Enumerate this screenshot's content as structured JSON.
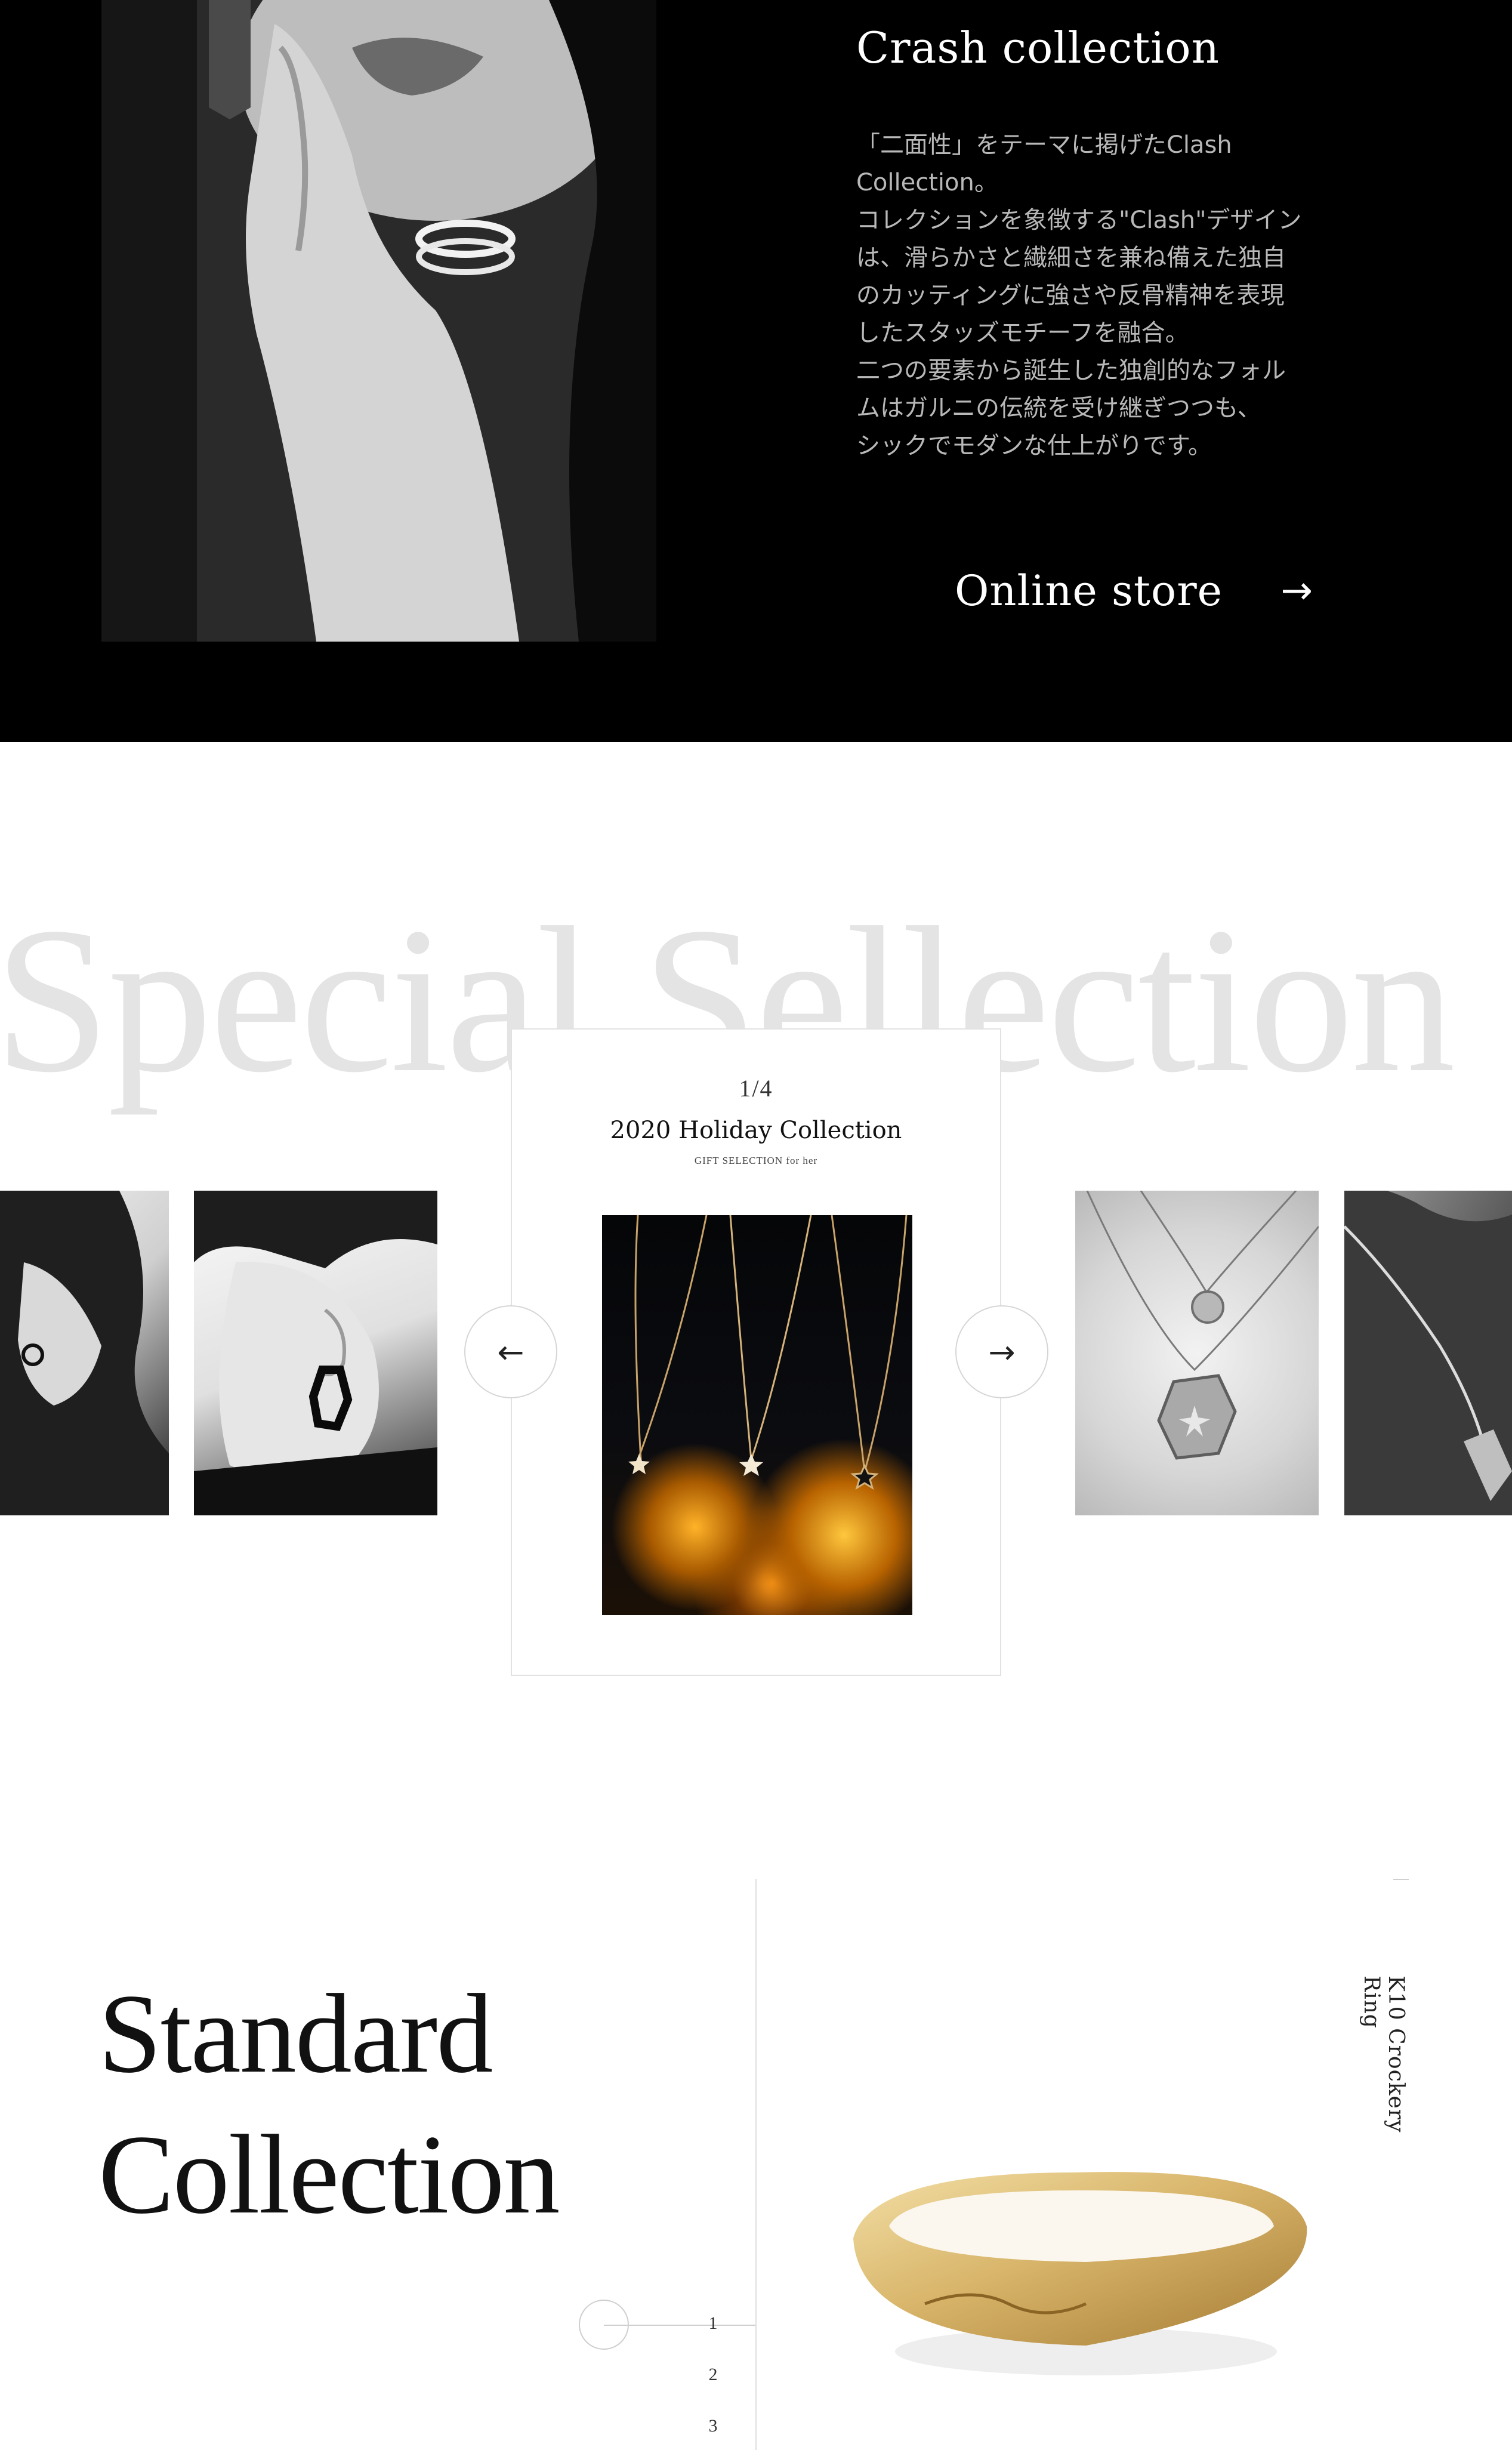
{
  "crash": {
    "title": "Crash collection",
    "description_lines": [
      "「二面性」をテーマに掲げたClash",
      "Collection。",
      "コレクションを象徴する\"Clash\"デザイン",
      "は、滑らかさと繊細さを兼ね備えた独自",
      "のカッティングに強さや反骨精神を表現",
      "したスタッズモチーフを融合。",
      "二つの要素から誕生した独創的なフォル",
      "ムはガルニの伝統を受け継ぎつつも、",
      "シックでモダンな仕上がりです。"
    ],
    "online_store_label": "Online store",
    "online_store_arrow": "→"
  },
  "special": {
    "background_text": "Special Sellection",
    "counter": "1/4",
    "feature_title": "2020 Holiday Collection",
    "feature_subtitle": "GIFT SELECTION for her",
    "prev_arrow": "←",
    "next_arrow": "→"
  },
  "standard": {
    "title_line1": "Standard",
    "title_line2": "Collection",
    "product_name": "K10 Crockery Ring",
    "pager": [
      "1",
      "2",
      "3"
    ],
    "active_page": 1
  }
}
